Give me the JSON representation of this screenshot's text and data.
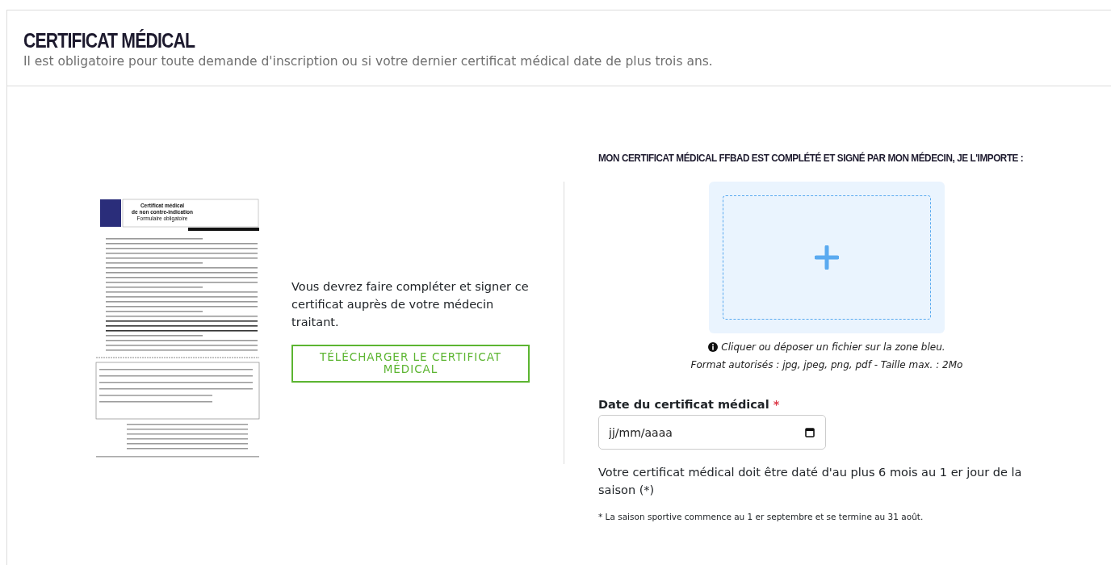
{
  "header": {
    "title": "CERTIFICAT MÉDICAL",
    "subtitle": "Il est obligatoire pour toute demande d'inscription ou si votre dernier certificat médical date de plus trois ans."
  },
  "download": {
    "document_preview": {
      "title_lines": [
        "Certificat médical",
        "de non contre-indication",
        "Formulaire obligatoire"
      ]
    },
    "instructions": "Vous devrez faire compléter et signer ce certificat auprès de votre médecin traitant.",
    "button": "TÉLÉCHARGER LE CERTIFICAT MÉDICAL"
  },
  "upload": {
    "heading": "MON CERTIFICAT MÉDICAL FFBAD EST COMPLÉTÉ ET SIGNÉ PAR MON MÉDECIN, JE L'IMPORTE :",
    "hint": "Cliquer ou déposer un fichier sur la zone bleu.",
    "formats": "Format autorisés : jpg, jpeg, png, pdf - Taille max. : 2Mo"
  },
  "date_field": {
    "label": "Date du certificat médical",
    "required_mark": "*",
    "placeholder": "jj/mm/aaaa"
  },
  "validity_note": "Votre certificat médical doit être daté d'au plus 6 mois au 1 er jour de la saison (*)",
  "footnote": "* La saison sportive commence au 1 er septembre et se termine au 31 août."
}
